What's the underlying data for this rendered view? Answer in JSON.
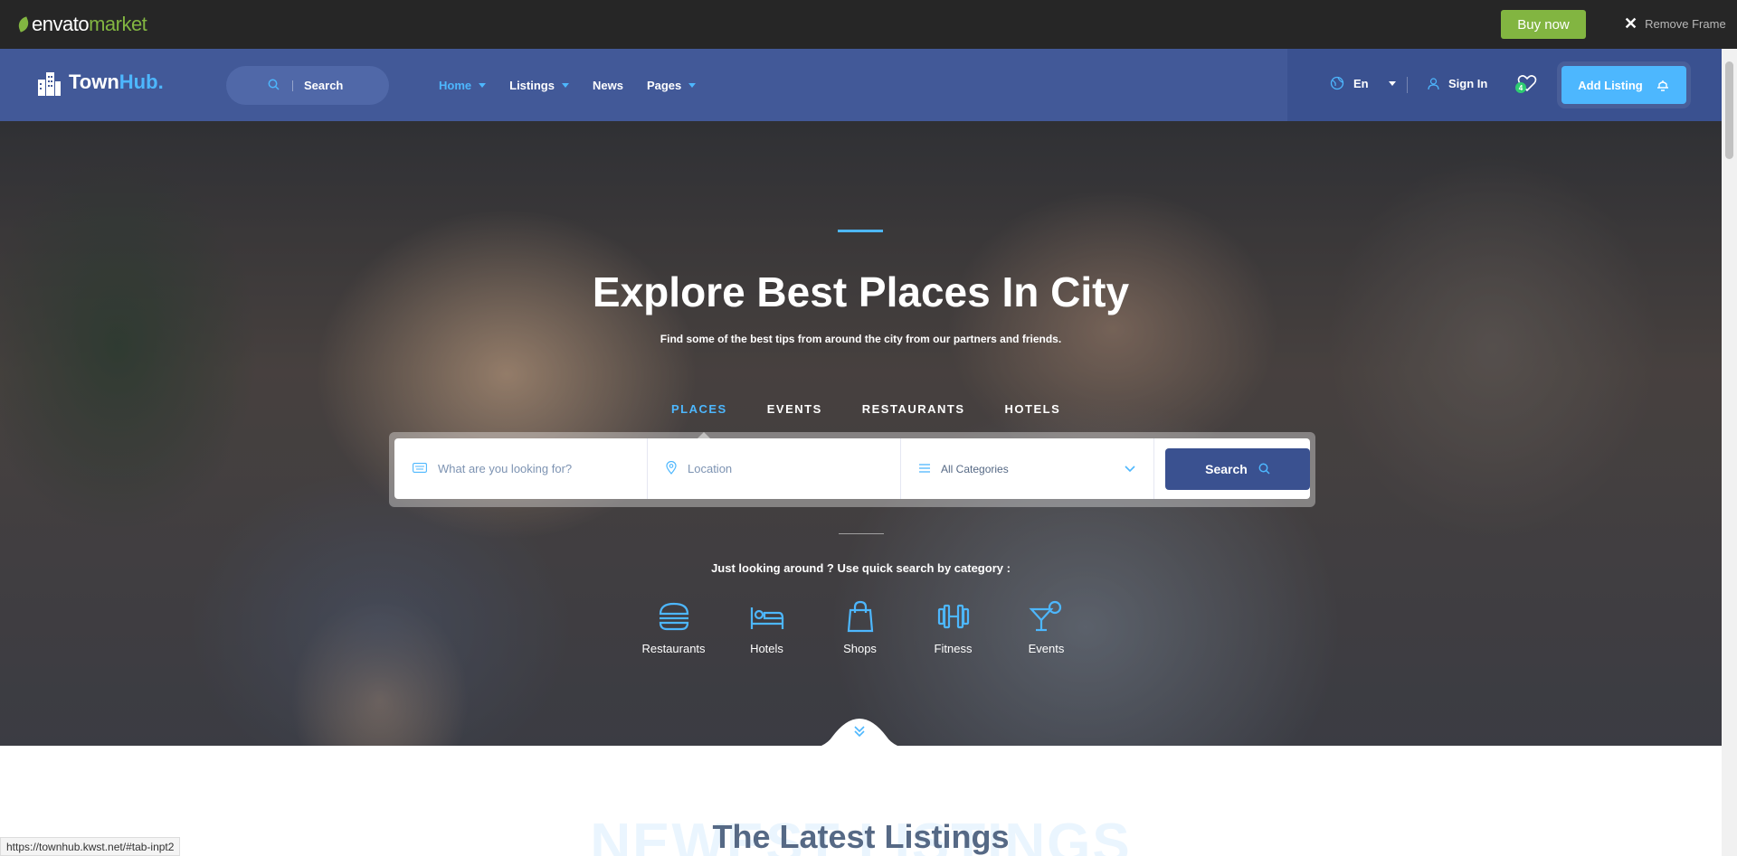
{
  "envato": {
    "logo_main": "envato",
    "logo_market": "market",
    "buy_now": "Buy now",
    "remove_frame": "Remove Frame"
  },
  "header": {
    "logo_town": "Town",
    "logo_hub": "Hub",
    "search_label": "Search",
    "nav": [
      {
        "label": "Home",
        "dropdown": true,
        "active": true
      },
      {
        "label": "Listings",
        "dropdown": true,
        "active": false
      },
      {
        "label": "News",
        "dropdown": false,
        "active": false
      },
      {
        "label": "Pages",
        "dropdown": true,
        "active": false
      }
    ],
    "language": "En",
    "sign_in": "Sign In",
    "wishlist_count": "4",
    "add_listing": "Add Listing"
  },
  "hero": {
    "title": "Explore Best Places In City",
    "subtitle": "Find some of the best tips from around the city from our partners and friends.",
    "tabs": [
      "PLACES",
      "EVENTS",
      "RESTAURANTS",
      "HOTELS"
    ],
    "active_tab": "PLACES",
    "search": {
      "keyword_placeholder": "What are you looking for?",
      "location_placeholder": "Location",
      "category_selected": "All Categories",
      "button": "Search"
    },
    "quick_text": "Just looking around ? Use quick search by category :",
    "categories": [
      {
        "label": "Restaurants",
        "icon": "burger-icon"
      },
      {
        "label": "Hotels",
        "icon": "bed-icon"
      },
      {
        "label": "Shops",
        "icon": "shopping-bag-icon"
      },
      {
        "label": "Fitness",
        "icon": "dumbbell-icon"
      },
      {
        "label": "Events",
        "icon": "cocktail-icon"
      }
    ]
  },
  "section": {
    "bg_text": "NEWEST LISTINGS",
    "title": "The Latest Listings"
  },
  "status_url": "https://townhub.kwst.net/#tab-inpt2",
  "colors": {
    "accent": "#4db7fe",
    "header": "#425998",
    "dark_blue": "#3a5190",
    "envato_green": "#82b541"
  }
}
